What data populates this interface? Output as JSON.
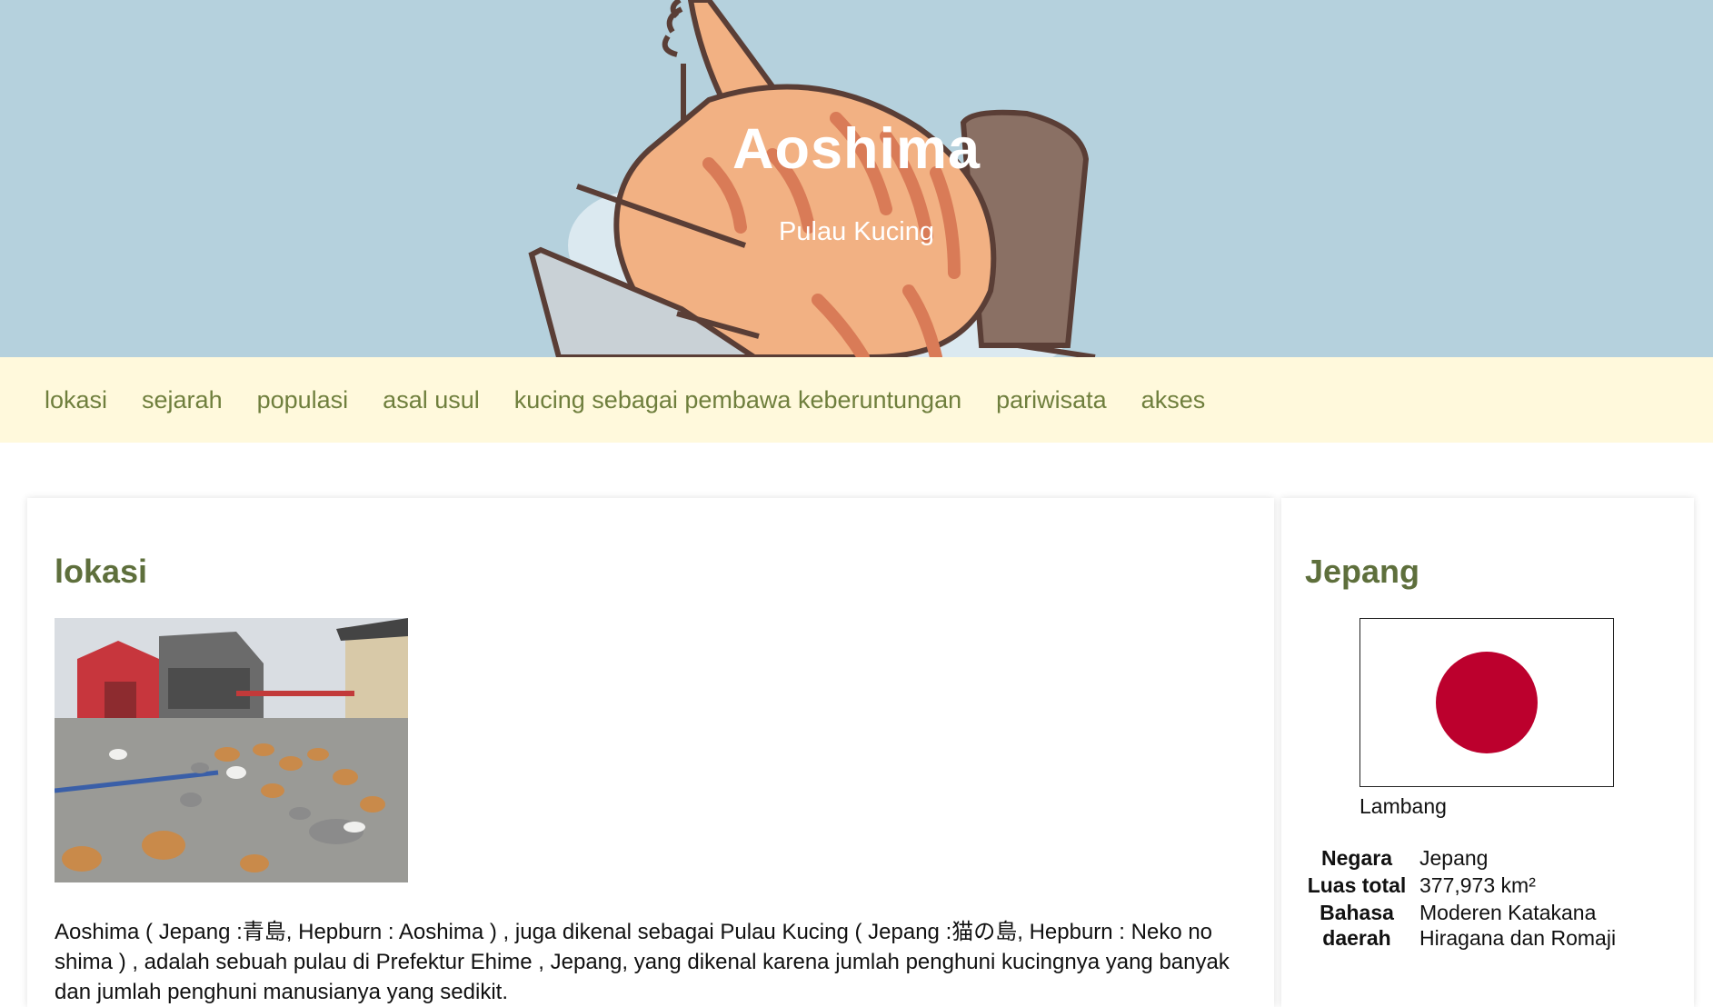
{
  "header": {
    "title": "Aoshima",
    "subtitle": "Pulau Kucing"
  },
  "nav": {
    "items": [
      "lokasi",
      "sejarah",
      "populasi",
      "asal usul",
      "kucing sebagai pembawa keberuntungan",
      "pariwisata",
      "akses"
    ]
  },
  "main": {
    "heading": "lokasi",
    "paragraph": "Aoshima ( Jepang :青島, Hepburn : Aoshima ) , juga dikenal sebagai Pulau Kucing ( Jepang :猫の島, Hepburn : Neko no shima ) , adalah sebuah pulau di Prefektur Ehime , Jepang, yang dikenal karena jumlah penghuni kucingnya yang banyak dan jumlah penghuni manusianya yang sedikit."
  },
  "sidebar": {
    "heading": "Jepang",
    "flag_caption": "Lambang",
    "flag_colors": {
      "field": "#ffffff",
      "disc": "#bc002d"
    },
    "info": [
      {
        "label": "Negara",
        "value": "Jepang"
      },
      {
        "label": "Luas total",
        "value": "377,973 km²"
      },
      {
        "label": "Bahasa daerah",
        "value": "Moderen Katakana Hiragana dan Romaji"
      }
    ]
  },
  "colors": {
    "header_bg": "#b5d1dd",
    "nav_bg": "#fff9dc",
    "nav_text": "#6f7f3d",
    "heading_text": "#5e6f3c"
  }
}
